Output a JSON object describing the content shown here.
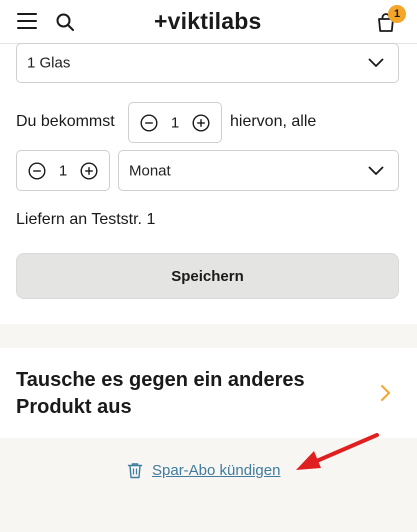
{
  "header": {
    "logo": "+viktilabs",
    "cart_count": "1"
  },
  "form": {
    "size_select_value": "1 Glas",
    "quantity_prefix": "Du bekommst",
    "quantity_value": "1",
    "quantity_suffix": "hiervon, alle",
    "interval_value": "1",
    "interval_unit_value": "Monat",
    "delivery_text": "Liefern an Teststr. 1",
    "save_label": "Speichern"
  },
  "swap": {
    "title": "Tausche es gegen ein anderes Produkt aus"
  },
  "footer": {
    "cancel_label": "Spar-Abo kündigen"
  },
  "colors": {
    "accent": "#f4a62a",
    "link": "#3f7c9e",
    "annotation_arrow": "#e02020"
  }
}
